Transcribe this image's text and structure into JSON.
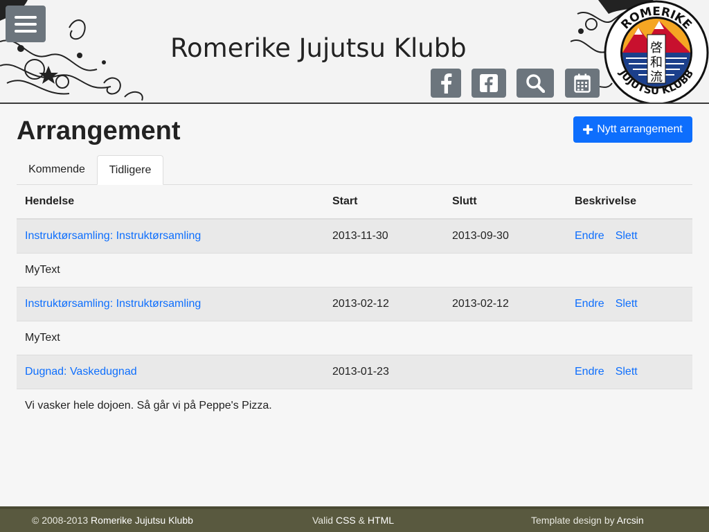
{
  "header": {
    "site_title": "Romerike Jujutsu Klubb",
    "icons": [
      "menu-icon",
      "facebook-icon",
      "facebook-square-icon",
      "search-icon",
      "calendar-icon"
    ],
    "logo_text_top": "ROMERIKE",
    "logo_text_bottom": "JUJUTSU KLUBB",
    "logo_kanji": [
      "啓",
      "和",
      "流"
    ]
  },
  "main": {
    "title": "Arrangement",
    "new_button_label": "Nytt arrangement",
    "tabs": [
      {
        "label": "Kommende",
        "active": false
      },
      {
        "label": "Tidligere",
        "active": true
      }
    ],
    "columns": [
      "Hendelse",
      "Start",
      "Slutt",
      "Beskrivelse"
    ],
    "events": [
      {
        "title": "Instruktørsamling: Instruktørsamling",
        "start": "2013-11-30",
        "end": "2013-09-30",
        "edit": "Endre",
        "delete": "Slett",
        "description": "MyText"
      },
      {
        "title": "Instruktørsamling: Instruktørsamling",
        "start": "2013-02-12",
        "end": "2013-02-12",
        "edit": "Endre",
        "delete": "Slett",
        "description": "MyText"
      },
      {
        "title": "Dugnad: Vaskedugnad",
        "start": "2013-01-23",
        "end": "",
        "edit": "Endre",
        "delete": "Slett",
        "description": "Vi vasker hele dojoen. Så går vi på Peppe's Pizza."
      }
    ]
  },
  "footer": {
    "copyright_prefix": "© 2008-2013",
    "copyright_name": "Romerike Jujutsu Klubb",
    "valid_prefix": "Valid",
    "valid_css": "CSS",
    "valid_and": "&",
    "valid_html": "HTML",
    "template_prefix": "Template design by",
    "template_author": "Arcsin"
  },
  "colors": {
    "primary": "#0d6efd",
    "icon_button": "#6c757d",
    "footer_bg": "#59593f"
  }
}
